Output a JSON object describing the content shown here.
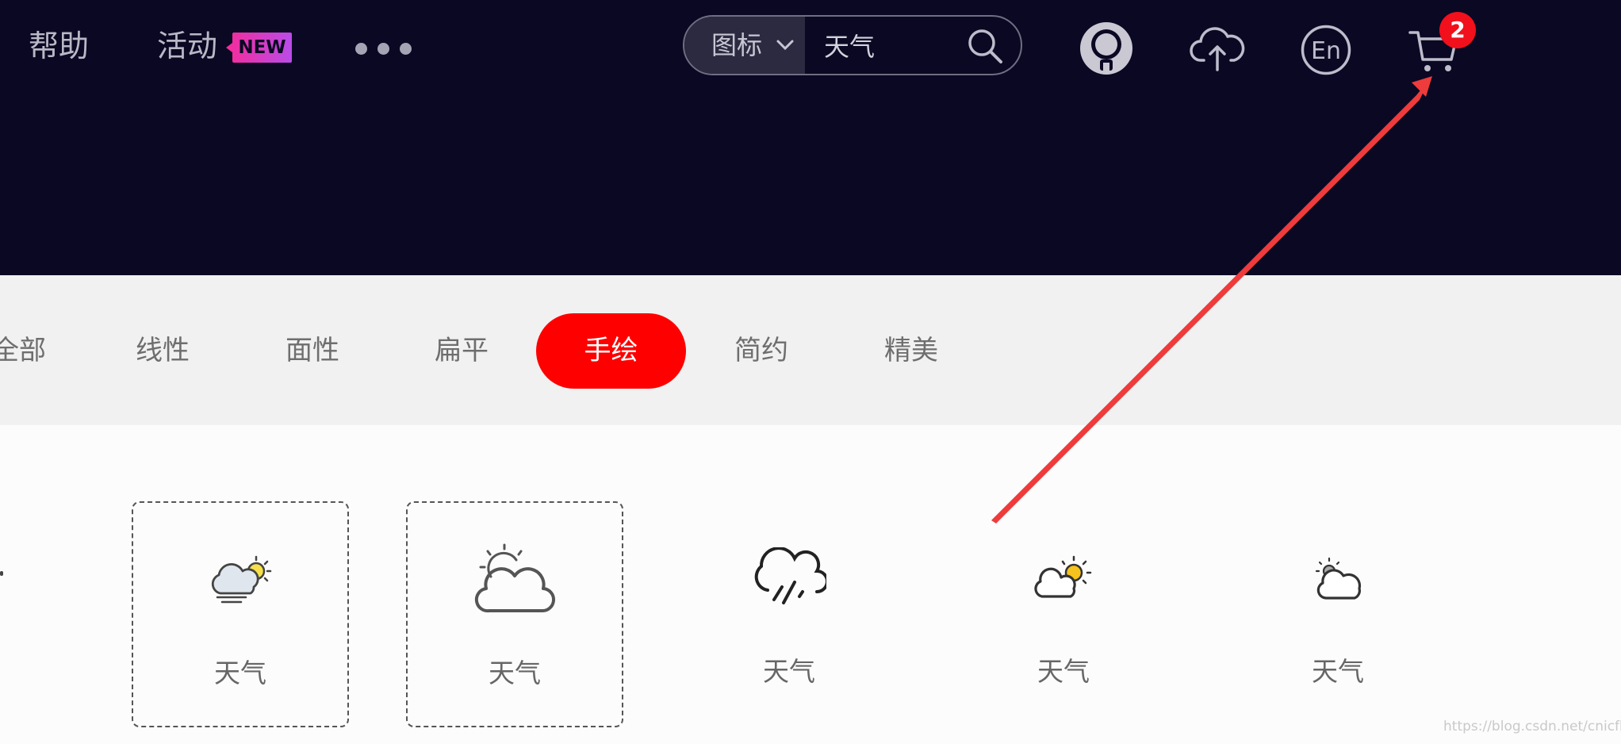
{
  "nav": {
    "help": "帮助",
    "activity": "活动",
    "activity_badge": "NEW",
    "more_icon": "more-dots-icon"
  },
  "search": {
    "type_label": "图标",
    "value": "天气",
    "icon": "search-icon"
  },
  "header_icons": [
    "avatar-icon",
    "upload-cloud-icon",
    "language-en-icon",
    "cart-icon"
  ],
  "language_label": "En",
  "cart": {
    "count": "2"
  },
  "categories": [
    {
      "label": "全部",
      "active": false
    },
    {
      "label": "线性",
      "active": false
    },
    {
      "label": "面性",
      "active": false
    },
    {
      "label": "扁平",
      "active": false
    },
    {
      "label": "手绘",
      "active": true
    },
    {
      "label": "简约",
      "active": false
    },
    {
      "label": "精美",
      "active": false
    }
  ],
  "icons": [
    {
      "label": "天气",
      "icon": "cloud-sun-fog-icon",
      "selected": true
    },
    {
      "label": "天气",
      "icon": "sun-behind-cloud-outline-icon",
      "selected": true
    },
    {
      "label": "天气",
      "icon": "cloud-rain-icon",
      "selected": false
    },
    {
      "label": "天气",
      "icon": "partly-cloudy-icon",
      "selected": false
    },
    {
      "label": "天气",
      "icon": "sun-cloud-small-icon",
      "selected": false
    }
  ],
  "colors": {
    "header_bg": "#0a0823",
    "accent": "#fe0000",
    "annotation_arrow": "#ee3b3b"
  },
  "watermark": "https://blog.csdn.net/cnicfhnui"
}
